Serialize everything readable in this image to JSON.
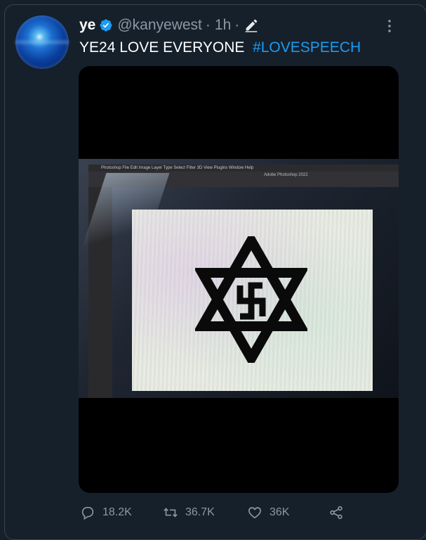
{
  "tweet": {
    "display_name": "ye",
    "handle": "@kanyewest",
    "separator": "·",
    "time": "1h",
    "text_main": "YE24 LOVE EVERYONE",
    "hashtag": "#LOVESPEECH",
    "verified": true,
    "hashtag_color": "#1d9bf0"
  },
  "media": {
    "ps_menu": "Photoshop  File  Edit  Image  Layer  Type  Select  Filter  3D  View  Plugins  Window  Help",
    "ps_title": "Adobe Photoshop 2022"
  },
  "actions": {
    "replies": "18.2K",
    "retweets": "36.7K",
    "likes": "36K"
  },
  "icons": {
    "verified": "verified-badge-icon",
    "edited": "pencil-icon",
    "more": "more-icon",
    "reply": "reply-icon",
    "retweet": "retweet-icon",
    "like": "heart-icon",
    "share": "share-icon"
  }
}
